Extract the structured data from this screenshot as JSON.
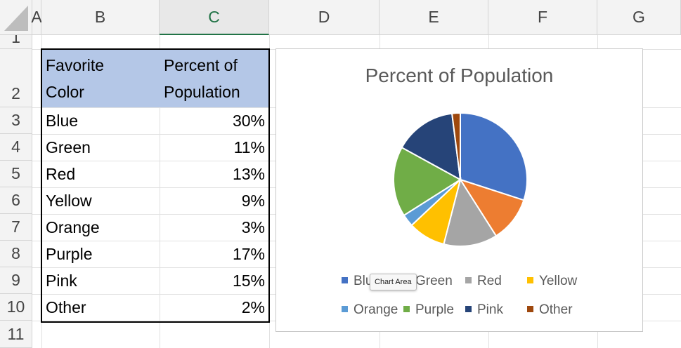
{
  "columns": [
    "A",
    "B",
    "C",
    "D",
    "E",
    "F",
    "G"
  ],
  "rows": [
    "1",
    "2",
    "3",
    "4",
    "5",
    "6",
    "7",
    "8",
    "9",
    "10",
    "11"
  ],
  "table": {
    "header": {
      "col1": "Favorite\nColor",
      "col1_line1": "Favorite",
      "col1_line2": "Color",
      "col2_line1": "Percent of",
      "col2_line2": "Population"
    },
    "rows": [
      {
        "color": "Blue",
        "percent": "30%"
      },
      {
        "color": "Green",
        "percent": "11%"
      },
      {
        "color": "Red",
        "percent": "13%"
      },
      {
        "color": "Yellow",
        "percent": "9%"
      },
      {
        "color": "Orange",
        "percent": "3%"
      },
      {
        "color": "Purple",
        "percent": "17%"
      },
      {
        "color": "Pink",
        "percent": "15%"
      },
      {
        "color": "Other",
        "percent": "2%"
      }
    ]
  },
  "tooltip": "Chart Area",
  "chart_data": {
    "type": "pie",
    "title": "Percent of Population",
    "categories": [
      "Blue",
      "Green",
      "Red",
      "Yellow",
      "Orange",
      "Purple",
      "Pink",
      "Other"
    ],
    "values": [
      30,
      11,
      13,
      9,
      3,
      17,
      15,
      2
    ],
    "colors": [
      "#4472c4",
      "#ed7d31",
      "#a5a5a5",
      "#ffc000",
      "#5b9bd5",
      "#70ad47",
      "#264478",
      "#9e480e"
    ],
    "legend_placement": "bottom"
  }
}
